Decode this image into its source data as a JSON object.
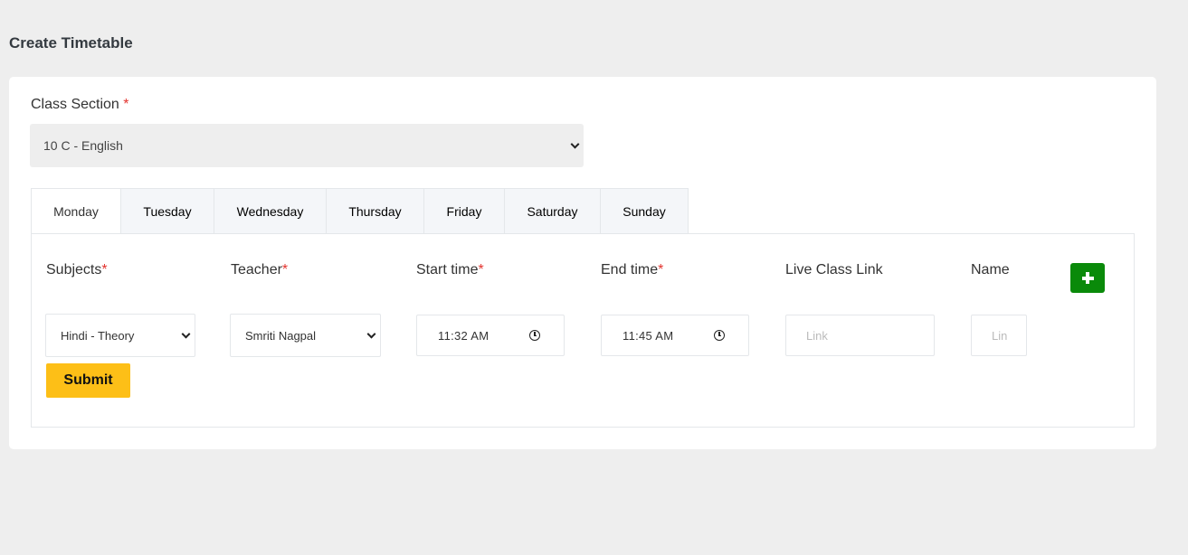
{
  "page": {
    "title": "Create Timetable"
  },
  "class_section": {
    "label": "Class Section",
    "required_mark": "*",
    "selected": "10 C - English"
  },
  "tabs": [
    {
      "label": "Monday",
      "active": true
    },
    {
      "label": "Tuesday"
    },
    {
      "label": "Wednesday"
    },
    {
      "label": "Thursday"
    },
    {
      "label": "Friday"
    },
    {
      "label": "Saturday"
    },
    {
      "label": "Sunday"
    }
  ],
  "columns": {
    "subjects": "Subjects",
    "teacher": "Teacher",
    "start_time": "Start time",
    "end_time": "End time",
    "live_class_link": "Live Class Link",
    "name": "Name",
    "required_mark": "*"
  },
  "row": {
    "subject": "Hindi - Theory",
    "teacher": "Smriti Nagpal",
    "start_time": "11:32  AM",
    "end_time": "11:45  AM",
    "link_placeholder": "Link",
    "name_placeholder": "Lin"
  },
  "actions": {
    "submit": "Submit",
    "add_icon": "plus-icon"
  },
  "colors": {
    "add_button": "#0a8a0a",
    "submit_button": "#fdbf17",
    "required": "#e3342f"
  }
}
